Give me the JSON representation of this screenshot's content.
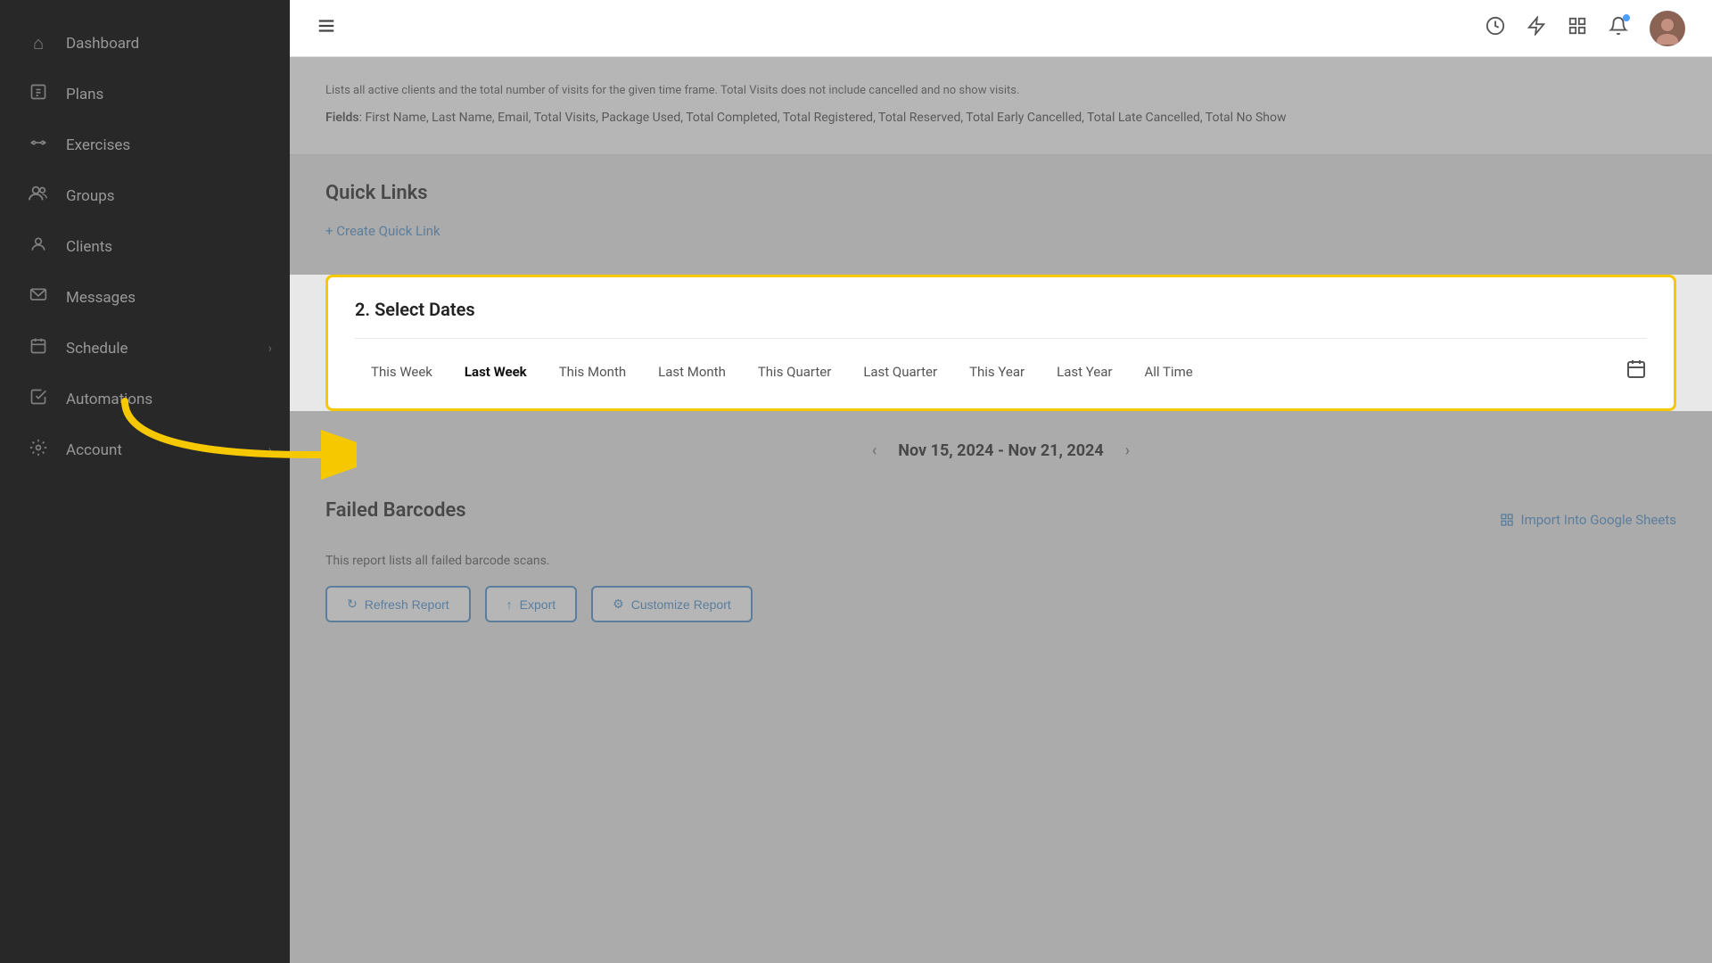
{
  "sidebar": {
    "items": [
      {
        "id": "dashboard",
        "label": "Dashboard",
        "icon": "⌂",
        "hasArrow": false
      },
      {
        "id": "plans",
        "label": "Plans",
        "icon": "📋",
        "hasArrow": false
      },
      {
        "id": "exercises",
        "label": "Exercises",
        "icon": "🏋",
        "hasArrow": false
      },
      {
        "id": "groups",
        "label": "Groups",
        "icon": "👥",
        "hasArrow": false
      },
      {
        "id": "clients",
        "label": "Clients",
        "icon": "👤",
        "hasArrow": false
      },
      {
        "id": "messages",
        "label": "Messages",
        "icon": "✉",
        "hasArrow": false
      },
      {
        "id": "schedule",
        "label": "Schedule",
        "icon": "📅",
        "hasArrow": true
      },
      {
        "id": "automations",
        "label": "Automations",
        "icon": "✔",
        "hasArrow": false
      },
      {
        "id": "account",
        "label": "Account",
        "icon": "⚙",
        "hasArrow": true
      }
    ]
  },
  "topbar": {
    "hamburger_label": "☰",
    "icons": [
      "history",
      "lightning",
      "grid",
      "bell"
    ],
    "notification_active": true
  },
  "fields_section": {
    "description": "Lists all active clients and the total number of visits for the given time frame. Total Visits does not include cancelled and no show visits.",
    "fields_label": "Fields",
    "fields_value": "First Name, Last Name, Email, Total Visits, Package Used, Total Completed, Total Registered, Total Reserved, Total Early Cancelled, Total Late Cancelled, Total No Show"
  },
  "quick_links": {
    "title": "Quick Links",
    "create_link_label": "+ Create Quick Link"
  },
  "select_dates": {
    "title": "2. Select Dates",
    "options": [
      {
        "id": "this-week",
        "label": "This Week",
        "active": false
      },
      {
        "id": "last-week",
        "label": "Last Week",
        "active": true
      },
      {
        "id": "this-month",
        "label": "This Month",
        "active": false
      },
      {
        "id": "last-month",
        "label": "Last Month",
        "active": false
      },
      {
        "id": "this-quarter",
        "label": "This Quarter",
        "active": false
      },
      {
        "id": "last-quarter",
        "label": "Last Quarter",
        "active": false
      },
      {
        "id": "this-year",
        "label": "This Year",
        "active": false
      },
      {
        "id": "last-year",
        "label": "Last Year",
        "active": false
      },
      {
        "id": "all-time",
        "label": "All Time",
        "active": false
      }
    ]
  },
  "date_range": {
    "text": "Nov 15, 2024 - Nov 21, 2024",
    "prev_label": "‹",
    "next_label": "›"
  },
  "failed_barcodes": {
    "title": "Failed Barcodes",
    "import_label": "Import Into Google Sheets",
    "description": "This report lists all failed barcode scans.",
    "buttons": [
      {
        "id": "refresh",
        "label": "Refresh Report",
        "icon": "↻"
      },
      {
        "id": "export",
        "label": "Export",
        "icon": "↑"
      },
      {
        "id": "customize",
        "label": "Customize Report",
        "icon": "⚙"
      }
    ]
  },
  "annotation": {
    "arrow_color": "#f5c800"
  }
}
